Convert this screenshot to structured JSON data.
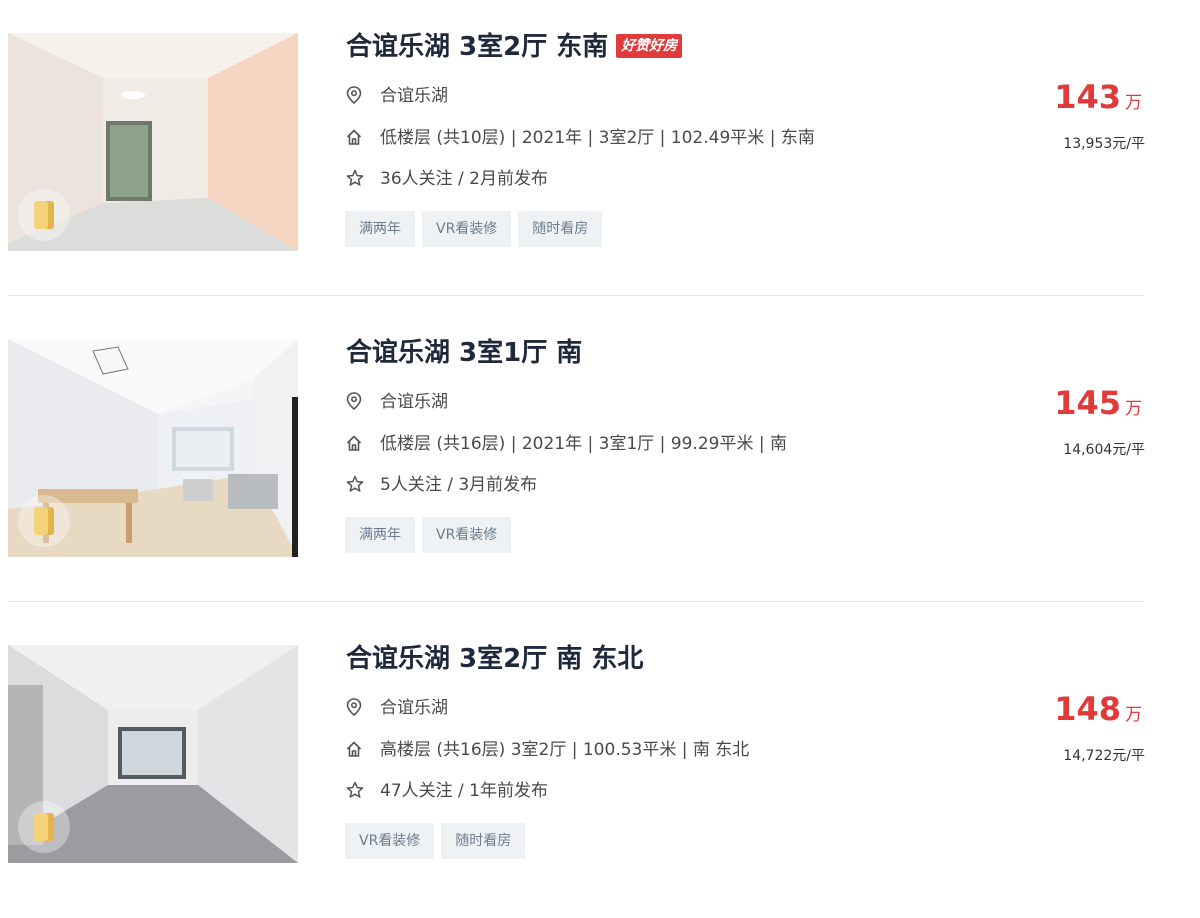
{
  "listings": [
    {
      "title": "合谊乐湖 3室2厅 东南",
      "badge": "好赞好房",
      "community": "合谊乐湖",
      "house_info": "低楼层 (共10层) | 2021年 | 3室2厅 | 102.49平米 | 东南",
      "follow_info": "36人关注 / 2月前发布",
      "tags": [
        "满两年",
        "VR看装修",
        "随时看房"
      ],
      "total_price": "143",
      "price_unit": "万",
      "unit_price": "13,953元/平"
    },
    {
      "title": "合谊乐湖 3室1厅 南",
      "badge": "",
      "community": "合谊乐湖",
      "house_info": "低楼层 (共16层) | 2021年 | 3室1厅 | 99.29平米 | 南",
      "follow_info": "5人关注 / 3月前发布",
      "tags": [
        "满两年",
        "VR看装修"
      ],
      "total_price": "145",
      "price_unit": "万",
      "unit_price": "14,604元/平"
    },
    {
      "title": "合谊乐湖 3室2厅 南 东北",
      "badge": "",
      "community": "合谊乐湖",
      "house_info": "高楼层 (共16层) 3室2厅 | 100.53平米 | 南 东北",
      "follow_info": "47人关注 / 1年前发布",
      "tags": [
        "VR看装修",
        "随时看房"
      ],
      "total_price": "148",
      "price_unit": "万",
      "unit_price": "14,722元/平"
    }
  ],
  "icons": {
    "location": "location-pin-icon",
    "house": "house-icon",
    "star": "star-outline-icon",
    "vr": "vr-cube-icon"
  },
  "colors": {
    "price": "#e03a3a",
    "title": "#1e2a3c",
    "tag_bg": "#eef2f5",
    "tag_text": "#6b7d8f"
  }
}
